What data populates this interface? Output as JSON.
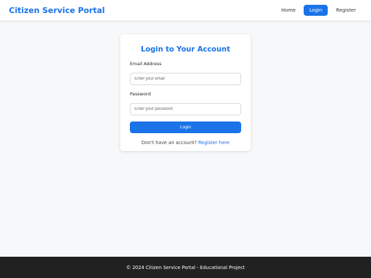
{
  "header": {
    "brand": "Citizen Service Portal",
    "nav": {
      "home": "Home",
      "login": "Login",
      "register": "Register"
    }
  },
  "login_card": {
    "title": "Login to Your Account",
    "email_label": "Email Address",
    "email_placeholder": "Enter your email",
    "password_label": "Password",
    "password_placeholder": "Enter your password",
    "submit_label": "Login",
    "register_prompt": "Don't have an account?",
    "register_link": "Register here"
  },
  "footer": {
    "text": "© 2024 Citizen Service Portal - Educational Project"
  },
  "colors": {
    "accent": "#1a73e8",
    "footer_bg": "#212121",
    "page_bg": "#f7f8fa"
  }
}
